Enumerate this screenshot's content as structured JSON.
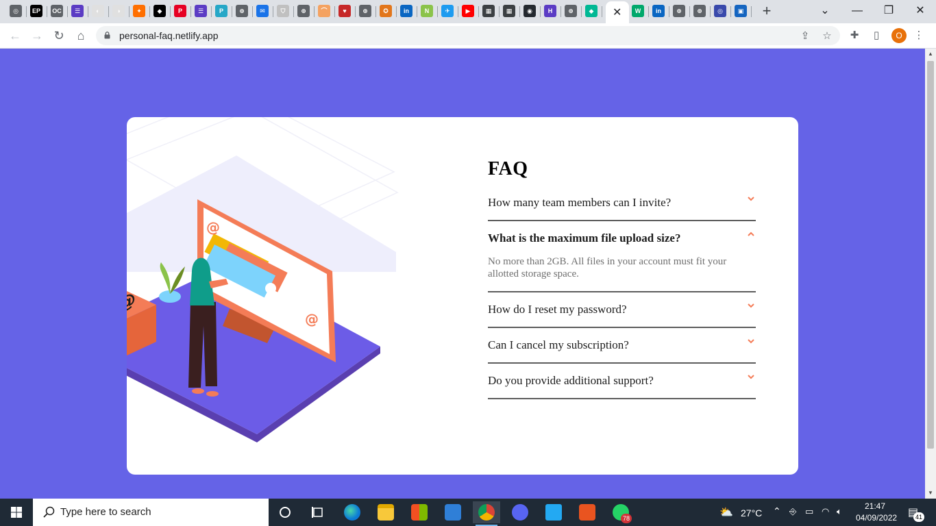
{
  "browser": {
    "tab_favicons": [
      {
        "name": "tab-favicon-1",
        "glyph": "◎",
        "color": "#5f6368"
      },
      {
        "name": "tab-favicon-2",
        "glyph": "EP",
        "color": "#000000"
      },
      {
        "name": "tab-favicon-3",
        "glyph": "OC",
        "color": "#5f6368"
      },
      {
        "name": "tab-favicon-4",
        "glyph": "☰",
        "color": "#5b3cc4"
      },
      {
        "name": "tab-favicon-5",
        "glyph": "◐",
        "color": "#e0e0e0"
      },
      {
        "name": "tab-favicon-6",
        "glyph": "◑",
        "color": "#e0e0e0"
      },
      {
        "name": "tab-favicon-7",
        "glyph": "✦",
        "color": "#ff6f00"
      },
      {
        "name": "tab-favicon-8",
        "glyph": "◆",
        "color": "#000000"
      },
      {
        "name": "tab-favicon-9",
        "glyph": "P",
        "color": "#e60023"
      },
      {
        "name": "tab-favicon-10",
        "glyph": "☰",
        "color": "#5b3cc4"
      },
      {
        "name": "tab-favicon-11",
        "glyph": "P",
        "color": "#26a7c7"
      },
      {
        "name": "tab-favicon-12",
        "glyph": "⊕",
        "color": "#5f6368"
      },
      {
        "name": "tab-favicon-13",
        "glyph": "✉",
        "color": "#1a73e8"
      },
      {
        "name": "tab-favicon-14",
        "glyph": "⛉",
        "color": "#c0c0c0"
      },
      {
        "name": "tab-favicon-15",
        "glyph": "⊕",
        "color": "#5f6368"
      },
      {
        "name": "tab-favicon-16",
        "glyph": "⌒",
        "color": "#f4a261"
      },
      {
        "name": "tab-favicon-17",
        "glyph": "♥",
        "color": "#c62828"
      },
      {
        "name": "tab-favicon-18",
        "glyph": "⊕",
        "color": "#5f6368"
      },
      {
        "name": "tab-favicon-19",
        "glyph": "✪",
        "color": "#e2761b"
      },
      {
        "name": "tab-favicon-20",
        "glyph": "in",
        "color": "#0a66c2"
      },
      {
        "name": "tab-favicon-21",
        "glyph": "N",
        "color": "#8bc34a"
      },
      {
        "name": "tab-favicon-22",
        "glyph": "✈",
        "color": "#1d9bf0"
      },
      {
        "name": "tab-favicon-23",
        "glyph": "▶",
        "color": "#ff0000"
      },
      {
        "name": "tab-favicon-24",
        "glyph": "▦",
        "color": "#3c4043"
      },
      {
        "name": "tab-favicon-25",
        "glyph": "▦",
        "color": "#3c4043"
      },
      {
        "name": "tab-favicon-26",
        "glyph": "◉",
        "color": "#24292f"
      },
      {
        "name": "tab-favicon-27",
        "glyph": "H",
        "color": "#5b3cc4"
      },
      {
        "name": "tab-favicon-28",
        "glyph": "⊕",
        "color": "#5f6368"
      },
      {
        "name": "tab-favicon-29",
        "glyph": "◆",
        "color": "#00b894"
      }
    ],
    "tab_favicons_after": [
      {
        "name": "tab-favicon-30",
        "glyph": "W",
        "color": "#00a86b"
      },
      {
        "name": "tab-favicon-31",
        "glyph": "in",
        "color": "#0a66c2"
      },
      {
        "name": "tab-favicon-32",
        "glyph": "⊕",
        "color": "#5f6368"
      },
      {
        "name": "tab-favicon-33",
        "glyph": "⊕",
        "color": "#5f6368"
      },
      {
        "name": "tab-favicon-34",
        "glyph": "◎",
        "color": "#3949ab"
      },
      {
        "name": "tab-favicon-35",
        "glyph": "▣",
        "color": "#1565c0"
      }
    ],
    "active_tab_close": "✕",
    "new_tab": "+",
    "url": "personal-faq.netlify.app",
    "profile_initial": "O"
  },
  "faq": {
    "title": "FAQ",
    "items": [
      {
        "question": "How many team members can I invite?",
        "answer": "",
        "open": false
      },
      {
        "question": "What is the maximum file upload size?",
        "answer": "No more than 2GB. All files in your account must fit your allotted storage space.",
        "open": true
      },
      {
        "question": "How do I reset my password?",
        "answer": "",
        "open": false
      },
      {
        "question": "Can I cancel my subscription?",
        "answer": "",
        "open": false
      },
      {
        "question": "Do you provide additional support?",
        "answer": "",
        "open": false
      }
    ],
    "accent": "#f47c57"
  },
  "colors": {
    "page_bg": "#6563e7",
    "card_bg": "#ffffff",
    "divider": "#5c5c5c"
  },
  "taskbar": {
    "search_placeholder": "Type here to search",
    "weather": "27°C",
    "time": "21:47",
    "date": "04/09/2022",
    "whatsapp_badge": "78",
    "notifications_badge": "41"
  }
}
